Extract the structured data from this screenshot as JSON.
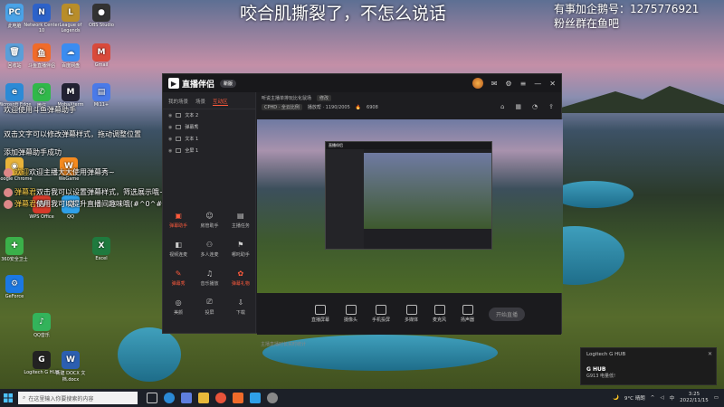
{
  "stream_overlay": {
    "title": "咬合肌撕裂了，不怎么说话",
    "qq_line1": "有事加企鹅号：1275776921",
    "qq_line2": "粉丝群在鱼吧"
  },
  "desktop_icons": [
    {
      "label": "此电脑",
      "color": "#4aa3e8",
      "glyph": "PC"
    },
    {
      "label": "Network Center 10",
      "color": "#2d62c9",
      "glyph": "N"
    },
    {
      "label": "League of Legends",
      "color": "#b88d2a",
      "glyph": "L"
    },
    {
      "label": "OBS Studio",
      "color": "#333",
      "glyph": "●"
    },
    {
      "label": "回收站",
      "color": "#5b9ed8",
      "glyph": "🗑"
    },
    {
      "label": "斗鱼直播伴侣",
      "color": "#f06b2a",
      "glyph": "鱼"
    },
    {
      "label": "百度网盘",
      "color": "#3b8cf0",
      "glyph": "☁"
    },
    {
      "label": "Gmail",
      "color": "#d94a3b",
      "glyph": "M"
    },
    {
      "label": "Microsoft Edge",
      "color": "#2b8ad6",
      "glyph": "e"
    },
    {
      "label": "微信",
      "color": "#30b84a",
      "glyph": "✆"
    },
    {
      "label": "MobaXterm",
      "color": "#223",
      "glyph": "M"
    },
    {
      "label": "Mi11+",
      "color": "#4a7ae8",
      "glyph": "▤"
    },
    {
      "label": "Google Chrome",
      "color": "#e8b33a",
      "glyph": "◉"
    },
    {
      "label": "WeGame",
      "color": "#f58a1f",
      "glyph": "W"
    },
    {
      "label": "WPS Office",
      "color": "#d63a2a",
      "glyph": "W"
    },
    {
      "label": "QQ",
      "color": "#2fa0e8",
      "glyph": "Q"
    },
    {
      "label": "360安全卫士",
      "color": "#3bb04a",
      "glyph": "✚"
    },
    {
      "label": "Excel",
      "color": "#1f7a3e",
      "glyph": "X"
    },
    {
      "label": "GeForce",
      "color": "#1b78e2",
      "glyph": "⚙"
    },
    {
      "label": "QQ音乐",
      "color": "#33b35b",
      "glyph": "♪"
    },
    {
      "label": "Logitech G HUB",
      "color": "#222",
      "glyph": "G"
    },
    {
      "label": "新建 DOCX 文档.docx",
      "color": "#2c5fb0",
      "glyph": "W"
    }
  ],
  "danmaku": [
    {
      "name": "",
      "text": "欢迎使用斗鱼弹幕助手"
    },
    {
      "name": "",
      "text": "双击文字可以修改弹幕样式，拖动调整位置"
    },
    {
      "name": "",
      "text": "添加弹幕助手成功"
    },
    {
      "name": "欢迎",
      "text": "欢迎主播大大使用弹幕秀~"
    },
    {
      "name": "弹幕君",
      "text": "双击我可以设置弹幕样式，筛选展示哦~"
    },
    {
      "name": "弹幕君",
      "text": "使用我可以提升直播间趣味哦(#^0^#)"
    }
  ],
  "app": {
    "name": "直播伴侣",
    "version": "新版",
    "left_tabs": [
      "我的场景",
      "场景",
      "互动区"
    ],
    "active_tab": 2,
    "scenes": [
      "文本 2",
      "弹幕秀",
      "文本 1",
      "全屏 1"
    ],
    "tools": [
      {
        "label": "弹幕助手",
        "glyph": "▣",
        "red": true
      },
      {
        "label": "房管助手",
        "glyph": "☺",
        "red": false
      },
      {
        "label": "主播任务",
        "glyph": "▤",
        "red": false
      },
      {
        "label": "视频连麦",
        "glyph": "◧",
        "red": false
      },
      {
        "label": "多人连麦",
        "glyph": "⚇",
        "red": false
      },
      {
        "label": "哪吒助手",
        "glyph": "⚑",
        "red": false
      },
      {
        "label": "弹幕秀",
        "glyph": "✎",
        "red": true
      },
      {
        "label": "音乐播放",
        "glyph": "♫",
        "red": false
      },
      {
        "label": "弹幕礼物",
        "glyph": "✿",
        "red": true
      },
      {
        "label": "美颜",
        "glyph": "◎",
        "red": false
      },
      {
        "label": "投屏",
        "glyph": "⎚",
        "red": false
      },
      {
        "label": "下载",
        "glyph": "⇩",
        "red": false
      }
    ],
    "stream_title": "听说主播单排玩比化鼠场",
    "stream_tag": "修改",
    "room_info": "CPHD · 全云比例",
    "room_meta": "播放帮 · 1190/2005",
    "score": "6908",
    "bottom_buttons": [
      "直播屏幕",
      "摄像头",
      "手机投屏",
      "多媒体",
      "麦克风",
      "扬声器"
    ],
    "start_label": "开始直播",
    "hint_text": "主播直播时长实时统计"
  },
  "notification": {
    "app": "Logitech G HUB",
    "title": "G HUB",
    "subtitle": "G913 电量低!"
  },
  "taskbar": {
    "search_placeholder": "在这里输入你要搜索的内容",
    "weather": "9°C 晴朗",
    "time": "3:25",
    "date": "2022/11/15"
  }
}
